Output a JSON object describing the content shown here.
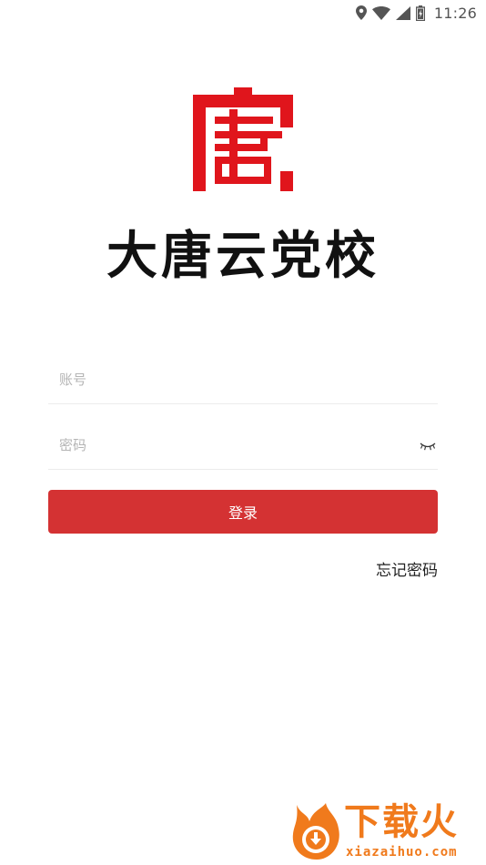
{
  "status_bar": {
    "time": "11:26",
    "icons": [
      "location-icon",
      "wifi-icon",
      "signal-icon",
      "battery-icon"
    ]
  },
  "branding": {
    "logo_icon": "tang-seal-logo-icon",
    "app_name": "大唐云党校",
    "brand_color": "#e0151c"
  },
  "login_form": {
    "account_placeholder": "账号",
    "account_value": "",
    "password_placeholder": "密码",
    "password_value": "",
    "password_toggle_icon": "eye-closed-icon",
    "submit_label": "登录",
    "submit_color": "#d43233",
    "forgot_password_label": "忘记密码"
  },
  "watermark": {
    "title": "下载火",
    "url": "xiazaihuo.com",
    "color": "#f07a1c"
  }
}
